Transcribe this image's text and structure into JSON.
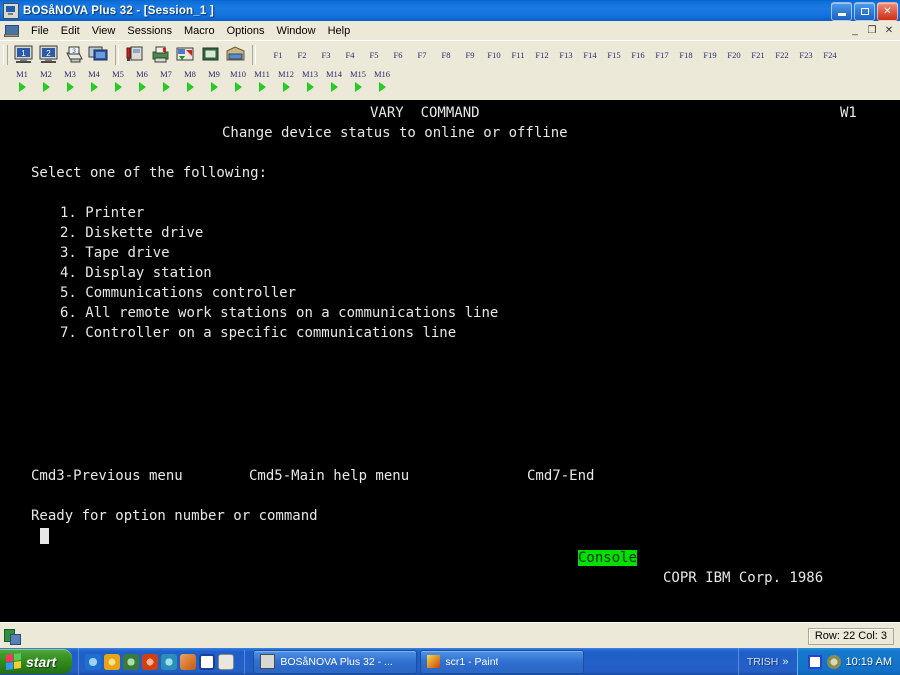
{
  "window": {
    "title": "BOSåNOVA Plus 32 - [Session_1 ]",
    "minimize_label": "",
    "maximize_label": "",
    "close_label": "✕",
    "mdi_minimize": "_",
    "mdi_restore": "❐",
    "mdi_close": "✕",
    "icon": "terminal-window-icon"
  },
  "menubar": {
    "app_icon": "computer-icon",
    "items": [
      {
        "label": "File"
      },
      {
        "label": "Edit"
      },
      {
        "label": "View"
      },
      {
        "label": "Sessions"
      },
      {
        "label": "Macro"
      },
      {
        "label": "Options"
      },
      {
        "label": "Window"
      },
      {
        "label": "Help"
      }
    ]
  },
  "toolbar": {
    "buttons": [
      {
        "name": "session-1-icon",
        "tip": "Session 1"
      },
      {
        "name": "session-2-icon",
        "tip": "Session 2"
      },
      {
        "name": "session-3-printer-icon",
        "tip": "Session 3 Printer"
      },
      {
        "name": "display-session-icon",
        "tip": "Display Session"
      },
      {
        "name": "keyboard-remap-icon",
        "tip": "Keyboard"
      },
      {
        "name": "printer-setup-icon",
        "tip": "Printer Setup"
      },
      {
        "name": "file-transfer-icon",
        "tip": "File Transfer"
      },
      {
        "name": "screen-capture-icon",
        "tip": "Screen Capture"
      },
      {
        "name": "archive-icon",
        "tip": "Archive"
      }
    ],
    "function_keys": [
      "F1",
      "F2",
      "F3",
      "F4",
      "F5",
      "F6",
      "F7",
      "F8",
      "F9",
      "F10",
      "F11",
      "F12",
      "F13",
      "F14",
      "F15",
      "F16",
      "F17",
      "F18",
      "F19",
      "F20",
      "F21",
      "F22",
      "F23",
      "F24"
    ],
    "macro_keys": [
      "M1",
      "M2",
      "M3",
      "M4",
      "M5",
      "M6",
      "M7",
      "M8",
      "M9",
      "M10",
      "M11",
      "M12",
      "M13",
      "M14",
      "M15",
      "M16"
    ]
  },
  "terminal": {
    "title": "VARY  COMMAND",
    "session_indicator": "W1",
    "subtitle": "Change device status to online or offline",
    "prompt_header": "Select one of the following:",
    "options": [
      {
        "number": "1.",
        "label": "Printer"
      },
      {
        "number": "2.",
        "label": "Diskette drive"
      },
      {
        "number": "3.",
        "label": "Tape drive"
      },
      {
        "number": "4.",
        "label": "Display station"
      },
      {
        "number": "5.",
        "label": "Communications controller"
      },
      {
        "number": "6.",
        "label": "All remote work stations on a communications line"
      },
      {
        "number": "7.",
        "label": "Controller on a specific communications line"
      }
    ],
    "command_keys": [
      {
        "label": "Cmd3-Previous menu"
      },
      {
        "label": "Cmd5-Main help menu"
      },
      {
        "label": "Cmd7-End"
      }
    ],
    "status_message": "Ready for option number or command",
    "console_badge": "Console",
    "copyright": "COPR IBM Corp. 1986",
    "colors": {
      "background": "#000000",
      "text": "#e8e8e8",
      "badge_background": "#00e000",
      "badge_text": "#003000"
    }
  },
  "statusbar": {
    "connection_icon": "connection-status-icon",
    "position": "Row: 22  Col: 3"
  },
  "taskbar": {
    "start_label": "start",
    "quick_launch": [
      {
        "name": "internet-explorer-icon",
        "color": "#1f6fd0"
      },
      {
        "name": "media-player-icon",
        "color": "#e8a417"
      },
      {
        "name": "browser-icon",
        "color": "#3a7a3a"
      },
      {
        "name": "antivirus-icon",
        "color": "#d04010"
      },
      {
        "name": "network-globe-icon",
        "color": "#2a8fb8"
      },
      {
        "name": "outlook-icon",
        "color": "#c25a10"
      },
      {
        "name": "word-icon",
        "color": "#1a3f9e"
      },
      {
        "name": "notepad-icon",
        "color": "#d8d8d0"
      }
    ],
    "tasks": [
      {
        "label": "BOSåNOVA Plus 32 - ...",
        "icon": "terminal-window-icon"
      },
      {
        "label": "scr1 - Paint",
        "icon": "paint-icon"
      }
    ],
    "language_bar": {
      "label": "TRISH",
      "chevron": "»"
    },
    "tray": [
      {
        "name": "volume-icon",
        "color": "#2a44c8"
      },
      {
        "name": "update-icon",
        "color": "#8a8a55"
      }
    ],
    "clock": "10:19 AM"
  }
}
